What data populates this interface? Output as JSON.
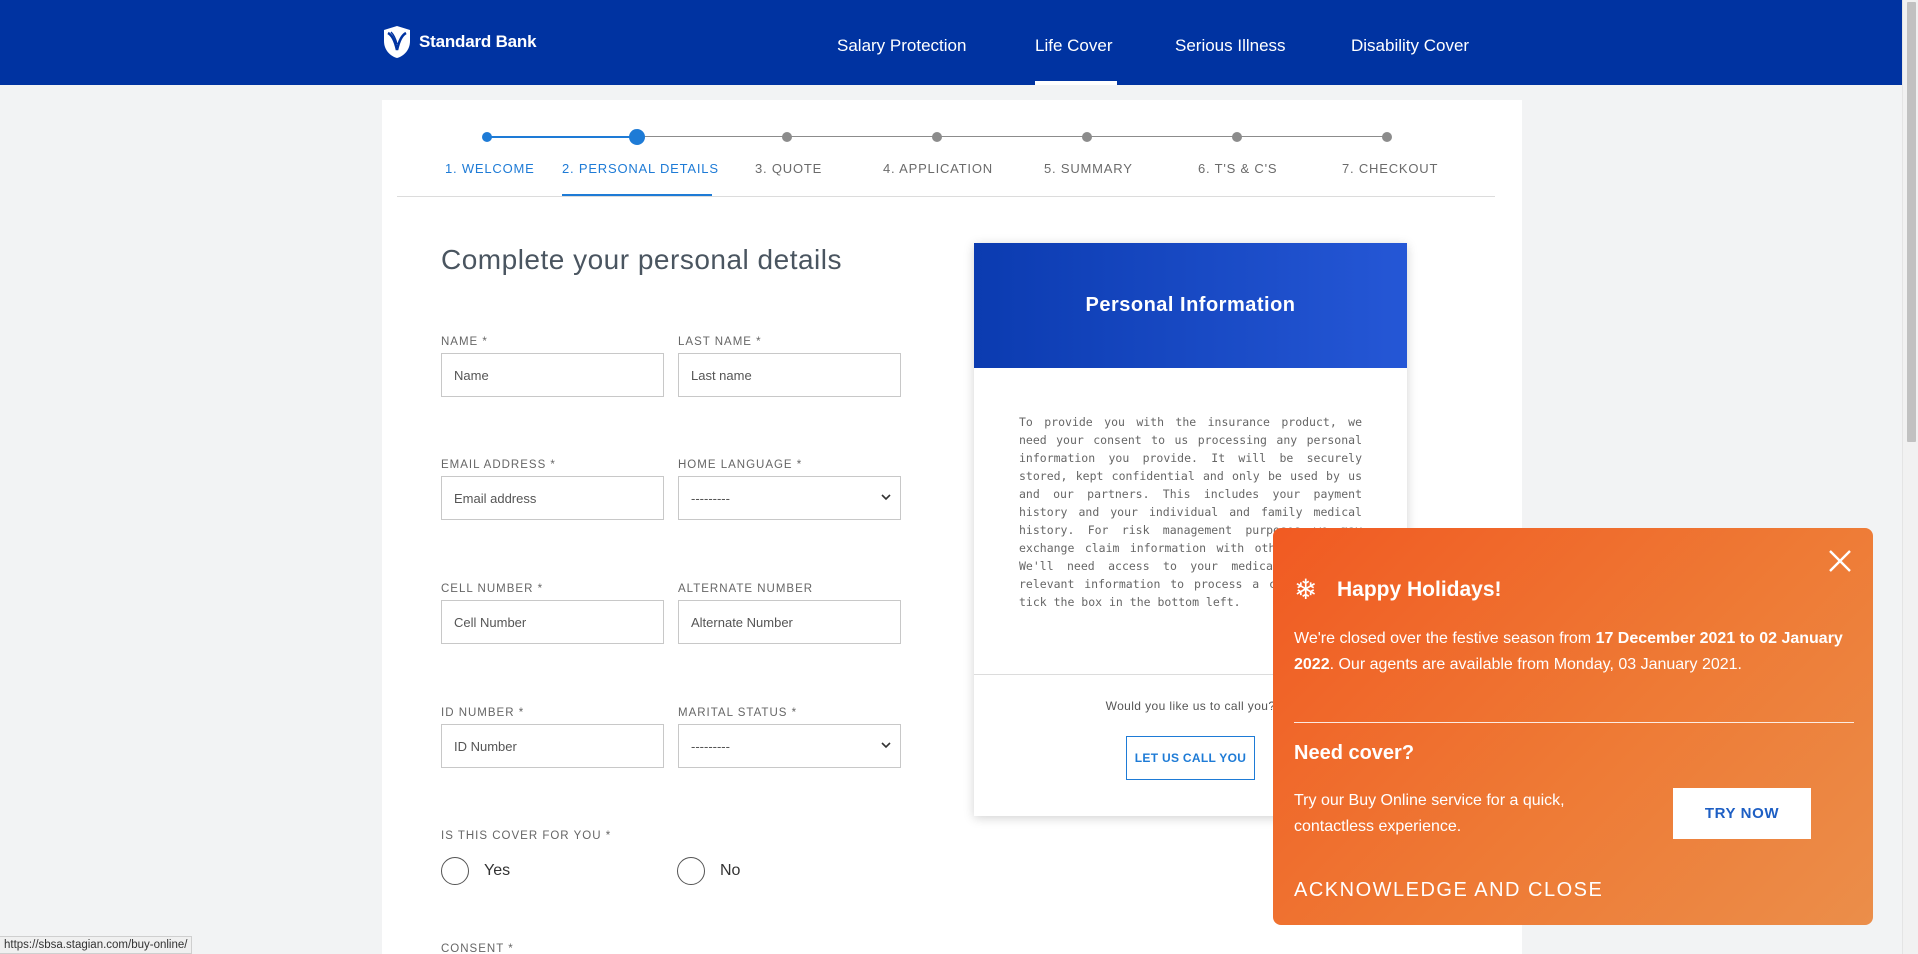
{
  "header": {
    "brand": "Standard Bank",
    "nav": [
      "Salary Protection",
      "Life Cover",
      "Serious Illness",
      "Disability Cover"
    ],
    "active_nav": "Life Cover"
  },
  "stepper": {
    "steps": [
      "1. WELCOME",
      "2. PERSONAL DETAILS",
      "3. QUOTE",
      "4. APPLICATION",
      "5. SUMMARY",
      "6. T'S & C'S",
      "7. CHECKOUT"
    ],
    "current_step": 2
  },
  "form": {
    "title": "Complete your personal details",
    "name": {
      "label": "NAME *",
      "placeholder": "Name"
    },
    "last_name": {
      "label": "LAST NAME *",
      "placeholder": "Last name"
    },
    "email": {
      "label": "EMAIL ADDRESS *",
      "placeholder": "Email address"
    },
    "home_language": {
      "label": "HOME LANGUAGE *",
      "value": "---------"
    },
    "cell": {
      "label": "CELL NUMBER *",
      "placeholder": "Cell Number"
    },
    "alternate": {
      "label": "ALTERNATE NUMBER",
      "placeholder": "Alternate Number"
    },
    "id_number": {
      "label": "ID NUMBER *",
      "placeholder": "ID Number"
    },
    "marital_status": {
      "label": "MARITAL STATUS *",
      "value": "---------"
    },
    "cover_for_you": {
      "label": "IS THIS COVER FOR YOU *",
      "yes": "Yes",
      "no": "No"
    },
    "consent_label": "CONSENT *"
  },
  "info_panel": {
    "title": "Personal Information",
    "body": "To provide you with the insurance product, we need your consent to us processing any personal information you provide. It will be securely stored, kept confidential and only be used by us and our partners. This includes your payment history and your individual and family medical history. For risk management purposes we may exchange claim information with other insurers. We'll need access to your medical and other relevant information to process a claim. Please tick the box in the bottom left.",
    "question": "Would you like us to call you?",
    "call_button": "LET US CALL YOU"
  },
  "popup": {
    "title": "Happy Holidays!",
    "text_prefix": "We're closed over the festive season from ",
    "text_bold": "17 December 2021 to 02 January 2022",
    "text_suffix": ". Our agents are available from Monday, 03 January 2021.",
    "need_title": "Need cover?",
    "need_text": "Try our Buy Online service for a quick, contactless experience.",
    "try_button": "TRY NOW",
    "ack_button": "ACKNOWLEDGE AND CLOSE"
  },
  "status_url": "https://sbsa.stagian.com/buy-online/",
  "colors": {
    "brand_blue": "#0033a1",
    "accent_blue": "#1e7bd6",
    "popup_orange": "#f15a22"
  }
}
